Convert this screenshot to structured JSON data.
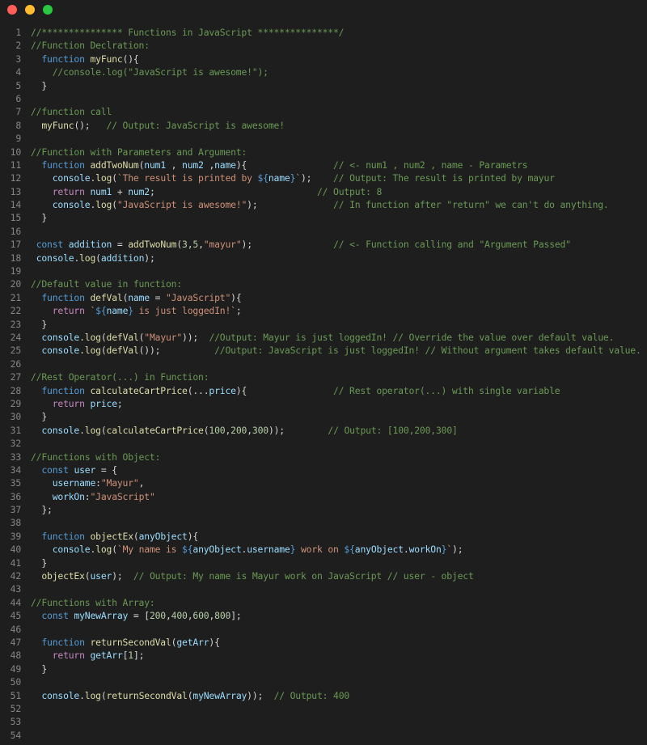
{
  "window": {
    "close_icon": "red-dot",
    "minimize_icon": "yellow-dot",
    "maximize_icon": "green-dot"
  },
  "colors": {
    "background": "#1e1e1e",
    "comment": "#6a9955",
    "keyword": "#569cd6",
    "control": "#c586c0",
    "function": "#dcdcaa",
    "variable": "#9cdcfe",
    "string": "#ce9178",
    "number": "#b5cea8",
    "line_number": "#858585"
  },
  "lines": [
    {
      "n": "1",
      "t": [
        [
          "cm",
          "//*************** Functions in JavaScript ***************/"
        ]
      ]
    },
    {
      "n": "2",
      "t": [
        [
          "cm",
          "//Function Declration:"
        ]
      ]
    },
    {
      "n": "3",
      "t": [
        [
          "pun",
          "  "
        ],
        [
          "kw",
          "function"
        ],
        [
          "pun",
          " "
        ],
        [
          "fn",
          "myFunc"
        ],
        [
          "pun",
          "(){"
        ]
      ]
    },
    {
      "n": "4",
      "t": [
        [
          "pun",
          "    "
        ],
        [
          "cm",
          "//console.log(\"JavaScript is awesome!\");"
        ]
      ]
    },
    {
      "n": "5",
      "t": [
        [
          "pun",
          "  }"
        ]
      ]
    },
    {
      "n": "6",
      "t": []
    },
    {
      "n": "7",
      "t": [
        [
          "cm",
          "//function call"
        ]
      ]
    },
    {
      "n": "8",
      "t": [
        [
          "pun",
          "  "
        ],
        [
          "fn",
          "myFunc"
        ],
        [
          "pun",
          "();   "
        ],
        [
          "cm",
          "// Output: JavaScript is awesome!"
        ]
      ]
    },
    {
      "n": "9",
      "t": []
    },
    {
      "n": "10",
      "t": [
        [
          "cm",
          "//Function with Parameters and Argument:"
        ]
      ]
    },
    {
      "n": "11",
      "t": [
        [
          "pun",
          "  "
        ],
        [
          "kw",
          "function"
        ],
        [
          "pun",
          " "
        ],
        [
          "fn",
          "addTwoNum"
        ],
        [
          "pun",
          "("
        ],
        [
          "var",
          "num1"
        ],
        [
          "pun",
          " , "
        ],
        [
          "var",
          "num2"
        ],
        [
          "pun",
          " ,"
        ],
        [
          "var",
          "name"
        ],
        [
          "pun",
          "){                "
        ],
        [
          "cm",
          "// <- num1 , num2 , name - Parametrs"
        ]
      ]
    },
    {
      "n": "12",
      "t": [
        [
          "pun",
          "    "
        ],
        [
          "var",
          "console"
        ],
        [
          "pun",
          "."
        ],
        [
          "fn",
          "log"
        ],
        [
          "pun",
          "("
        ],
        [
          "str",
          "`The result is printed by "
        ],
        [
          "tpl",
          "${"
        ],
        [
          "var",
          "name"
        ],
        [
          "tpl",
          "}"
        ],
        [
          "str",
          "`"
        ],
        [
          "pun",
          ");    "
        ],
        [
          "cm",
          "// Output: The result is printed by mayur"
        ]
      ]
    },
    {
      "n": "13",
      "t": [
        [
          "pun",
          "    "
        ],
        [
          "ctl",
          "return"
        ],
        [
          "pun",
          " "
        ],
        [
          "var",
          "num1"
        ],
        [
          "pun",
          " + "
        ],
        [
          "var",
          "num2"
        ],
        [
          "pun",
          ";                              "
        ],
        [
          "cm",
          "// Output: 8"
        ]
      ]
    },
    {
      "n": "14",
      "t": [
        [
          "pun",
          "    "
        ],
        [
          "var",
          "console"
        ],
        [
          "pun",
          "."
        ],
        [
          "fn",
          "log"
        ],
        [
          "pun",
          "("
        ],
        [
          "str",
          "\"JavaScript is awesome!\""
        ],
        [
          "pun",
          ");              "
        ],
        [
          "cm",
          "// In function after \"return\" we can't do anything."
        ]
      ]
    },
    {
      "n": "15",
      "t": [
        [
          "pun",
          "  }"
        ]
      ]
    },
    {
      "n": "16",
      "t": []
    },
    {
      "n": "17",
      "t": [
        [
          "pun",
          " "
        ],
        [
          "kw",
          "const"
        ],
        [
          "pun",
          " "
        ],
        [
          "var",
          "addition"
        ],
        [
          "pun",
          " = "
        ],
        [
          "fn",
          "addTwoNum"
        ],
        [
          "pun",
          "("
        ],
        [
          "num",
          "3"
        ],
        [
          "pun",
          ","
        ],
        [
          "num",
          "5"
        ],
        [
          "pun",
          ","
        ],
        [
          "str",
          "\"mayur\""
        ],
        [
          "pun",
          ");               "
        ],
        [
          "cm",
          "// <- Function calling and \"Argument Passed\""
        ]
      ]
    },
    {
      "n": "18",
      "t": [
        [
          "pun",
          " "
        ],
        [
          "var",
          "console"
        ],
        [
          "pun",
          "."
        ],
        [
          "fn",
          "log"
        ],
        [
          "pun",
          "("
        ],
        [
          "var",
          "addition"
        ],
        [
          "pun",
          ");"
        ]
      ]
    },
    {
      "n": "19",
      "t": []
    },
    {
      "n": "20",
      "t": [
        [
          "cm",
          "//Default value in function:"
        ]
      ]
    },
    {
      "n": "21",
      "t": [
        [
          "pun",
          "  "
        ],
        [
          "kw",
          "function"
        ],
        [
          "pun",
          " "
        ],
        [
          "fn",
          "defVal"
        ],
        [
          "pun",
          "("
        ],
        [
          "var",
          "name"
        ],
        [
          "pun",
          " = "
        ],
        [
          "str",
          "\"JavaScript\""
        ],
        [
          "pun",
          "){"
        ]
      ]
    },
    {
      "n": "22",
      "t": [
        [
          "pun",
          "    "
        ],
        [
          "ctl",
          "return"
        ],
        [
          "pun",
          " "
        ],
        [
          "str",
          "`"
        ],
        [
          "tpl",
          "${"
        ],
        [
          "var",
          "name"
        ],
        [
          "tpl",
          "}"
        ],
        [
          "str",
          " is just loggedIn!`"
        ],
        [
          "pun",
          ";"
        ]
      ]
    },
    {
      "n": "23",
      "t": [
        [
          "pun",
          "  }"
        ]
      ]
    },
    {
      "n": "24",
      "t": [
        [
          "pun",
          "  "
        ],
        [
          "var",
          "console"
        ],
        [
          "pun",
          "."
        ],
        [
          "fn",
          "log"
        ],
        [
          "pun",
          "("
        ],
        [
          "fn",
          "defVal"
        ],
        [
          "pun",
          "("
        ],
        [
          "str",
          "\"Mayur\""
        ],
        [
          "pun",
          "));  "
        ],
        [
          "cm",
          "//Output: Mayur is just loggedIn! // Override the value over default value."
        ]
      ]
    },
    {
      "n": "25",
      "t": [
        [
          "pun",
          "  "
        ],
        [
          "var",
          "console"
        ],
        [
          "pun",
          "."
        ],
        [
          "fn",
          "log"
        ],
        [
          "pun",
          "("
        ],
        [
          "fn",
          "defVal"
        ],
        [
          "pun",
          "());          "
        ],
        [
          "cm",
          "//Output: JavaScript is just loggedIn! // Without argument takes default value."
        ]
      ]
    },
    {
      "n": "26",
      "t": []
    },
    {
      "n": "27",
      "t": [
        [
          "cm",
          "//Rest Operator(...) in Function:"
        ]
      ]
    },
    {
      "n": "28",
      "t": [
        [
          "pun",
          "  "
        ],
        [
          "kw",
          "function"
        ],
        [
          "pun",
          " "
        ],
        [
          "fn",
          "calculateCartPrice"
        ],
        [
          "pun",
          "(..."
        ],
        [
          "var",
          "price"
        ],
        [
          "pun",
          "){                "
        ],
        [
          "cm",
          "// Rest operator(...) with single variable"
        ]
      ]
    },
    {
      "n": "29",
      "t": [
        [
          "pun",
          "    "
        ],
        [
          "ctl",
          "return"
        ],
        [
          "pun",
          " "
        ],
        [
          "var",
          "price"
        ],
        [
          "pun",
          ";"
        ]
      ]
    },
    {
      "n": "30",
      "t": [
        [
          "pun",
          "  }"
        ]
      ]
    },
    {
      "n": "31",
      "t": [
        [
          "pun",
          "  "
        ],
        [
          "var",
          "console"
        ],
        [
          "pun",
          "."
        ],
        [
          "fn",
          "log"
        ],
        [
          "pun",
          "("
        ],
        [
          "fn",
          "calculateCartPrice"
        ],
        [
          "pun",
          "("
        ],
        [
          "num",
          "100"
        ],
        [
          "pun",
          ","
        ],
        [
          "num",
          "200"
        ],
        [
          "pun",
          ","
        ],
        [
          "num",
          "300"
        ],
        [
          "pun",
          "));        "
        ],
        [
          "cm",
          "// Output: [100,200,300]"
        ]
      ]
    },
    {
      "n": "32",
      "t": []
    },
    {
      "n": "33",
      "t": [
        [
          "cm",
          "//Functions with Object:"
        ]
      ]
    },
    {
      "n": "34",
      "t": [
        [
          "pun",
          "  "
        ],
        [
          "kw",
          "const"
        ],
        [
          "pun",
          " "
        ],
        [
          "var",
          "user"
        ],
        [
          "pun",
          " = {"
        ]
      ]
    },
    {
      "n": "35",
      "t": [
        [
          "pun",
          "    "
        ],
        [
          "var",
          "username"
        ],
        [
          "pun",
          ":"
        ],
        [
          "str",
          "\"Mayur\""
        ],
        [
          "pun",
          ","
        ]
      ]
    },
    {
      "n": "36",
      "t": [
        [
          "pun",
          "    "
        ],
        [
          "var",
          "workOn"
        ],
        [
          "pun",
          ":"
        ],
        [
          "str",
          "\"JavaScript\""
        ]
      ]
    },
    {
      "n": "37",
      "t": [
        [
          "pun",
          "  };"
        ]
      ]
    },
    {
      "n": "38",
      "t": []
    },
    {
      "n": "39",
      "t": [
        [
          "pun",
          "  "
        ],
        [
          "kw",
          "function"
        ],
        [
          "pun",
          " "
        ],
        [
          "fn",
          "objectEx"
        ],
        [
          "pun",
          "("
        ],
        [
          "var",
          "anyObject"
        ],
        [
          "pun",
          "){"
        ]
      ]
    },
    {
      "n": "40",
      "t": [
        [
          "pun",
          "    "
        ],
        [
          "var",
          "console"
        ],
        [
          "pun",
          "."
        ],
        [
          "fn",
          "log"
        ],
        [
          "pun",
          "("
        ],
        [
          "str",
          "`My name is "
        ],
        [
          "tpl",
          "${"
        ],
        [
          "var",
          "anyObject"
        ],
        [
          "pun",
          "."
        ],
        [
          "var",
          "username"
        ],
        [
          "tpl",
          "}"
        ],
        [
          "str",
          " work on "
        ],
        [
          "tpl",
          "${"
        ],
        [
          "var",
          "anyObject"
        ],
        [
          "pun",
          "."
        ],
        [
          "var",
          "workOn"
        ],
        [
          "tpl",
          "}"
        ],
        [
          "str",
          "`"
        ],
        [
          "pun",
          ");"
        ]
      ]
    },
    {
      "n": "41",
      "t": [
        [
          "pun",
          "  }"
        ]
      ]
    },
    {
      "n": "42",
      "t": [
        [
          "pun",
          "  "
        ],
        [
          "fn",
          "objectEx"
        ],
        [
          "pun",
          "("
        ],
        [
          "var",
          "user"
        ],
        [
          "pun",
          ");  "
        ],
        [
          "cm",
          "// Output: My name is Mayur work on JavaScript // user - object"
        ]
      ]
    },
    {
      "n": "43",
      "t": []
    },
    {
      "n": "44",
      "t": [
        [
          "cm",
          "//Functions with Array:"
        ]
      ]
    },
    {
      "n": "45",
      "t": [
        [
          "pun",
          "  "
        ],
        [
          "kw",
          "const"
        ],
        [
          "pun",
          " "
        ],
        [
          "var",
          "myNewArray"
        ],
        [
          "pun",
          " = ["
        ],
        [
          "num",
          "200"
        ],
        [
          "pun",
          ","
        ],
        [
          "num",
          "400"
        ],
        [
          "pun",
          ","
        ],
        [
          "num",
          "600"
        ],
        [
          "pun",
          ","
        ],
        [
          "num",
          "800"
        ],
        [
          "pun",
          "];"
        ]
      ]
    },
    {
      "n": "46",
      "t": []
    },
    {
      "n": "47",
      "t": [
        [
          "pun",
          "  "
        ],
        [
          "kw",
          "function"
        ],
        [
          "pun",
          " "
        ],
        [
          "fn",
          "returnSecondVal"
        ],
        [
          "pun",
          "("
        ],
        [
          "var",
          "getArr"
        ],
        [
          "pun",
          "){"
        ]
      ]
    },
    {
      "n": "48",
      "t": [
        [
          "pun",
          "    "
        ],
        [
          "ctl",
          "return"
        ],
        [
          "pun",
          " "
        ],
        [
          "var",
          "getArr"
        ],
        [
          "pun",
          "["
        ],
        [
          "num",
          "1"
        ],
        [
          "pun",
          "];"
        ]
      ]
    },
    {
      "n": "49",
      "t": [
        [
          "pun",
          "  }"
        ]
      ]
    },
    {
      "n": "50",
      "t": []
    },
    {
      "n": "51",
      "t": [
        [
          "pun",
          "  "
        ],
        [
          "var",
          "console"
        ],
        [
          "pun",
          "."
        ],
        [
          "fn",
          "log"
        ],
        [
          "pun",
          "("
        ],
        [
          "fn",
          "returnSecondVal"
        ],
        [
          "pun",
          "("
        ],
        [
          "var",
          "myNewArray"
        ],
        [
          "pun",
          "));  "
        ],
        [
          "cm",
          "// Output: 400"
        ]
      ]
    },
    {
      "n": "52",
      "t": []
    },
    {
      "n": "53",
      "t": []
    },
    {
      "n": "54",
      "t": []
    }
  ]
}
